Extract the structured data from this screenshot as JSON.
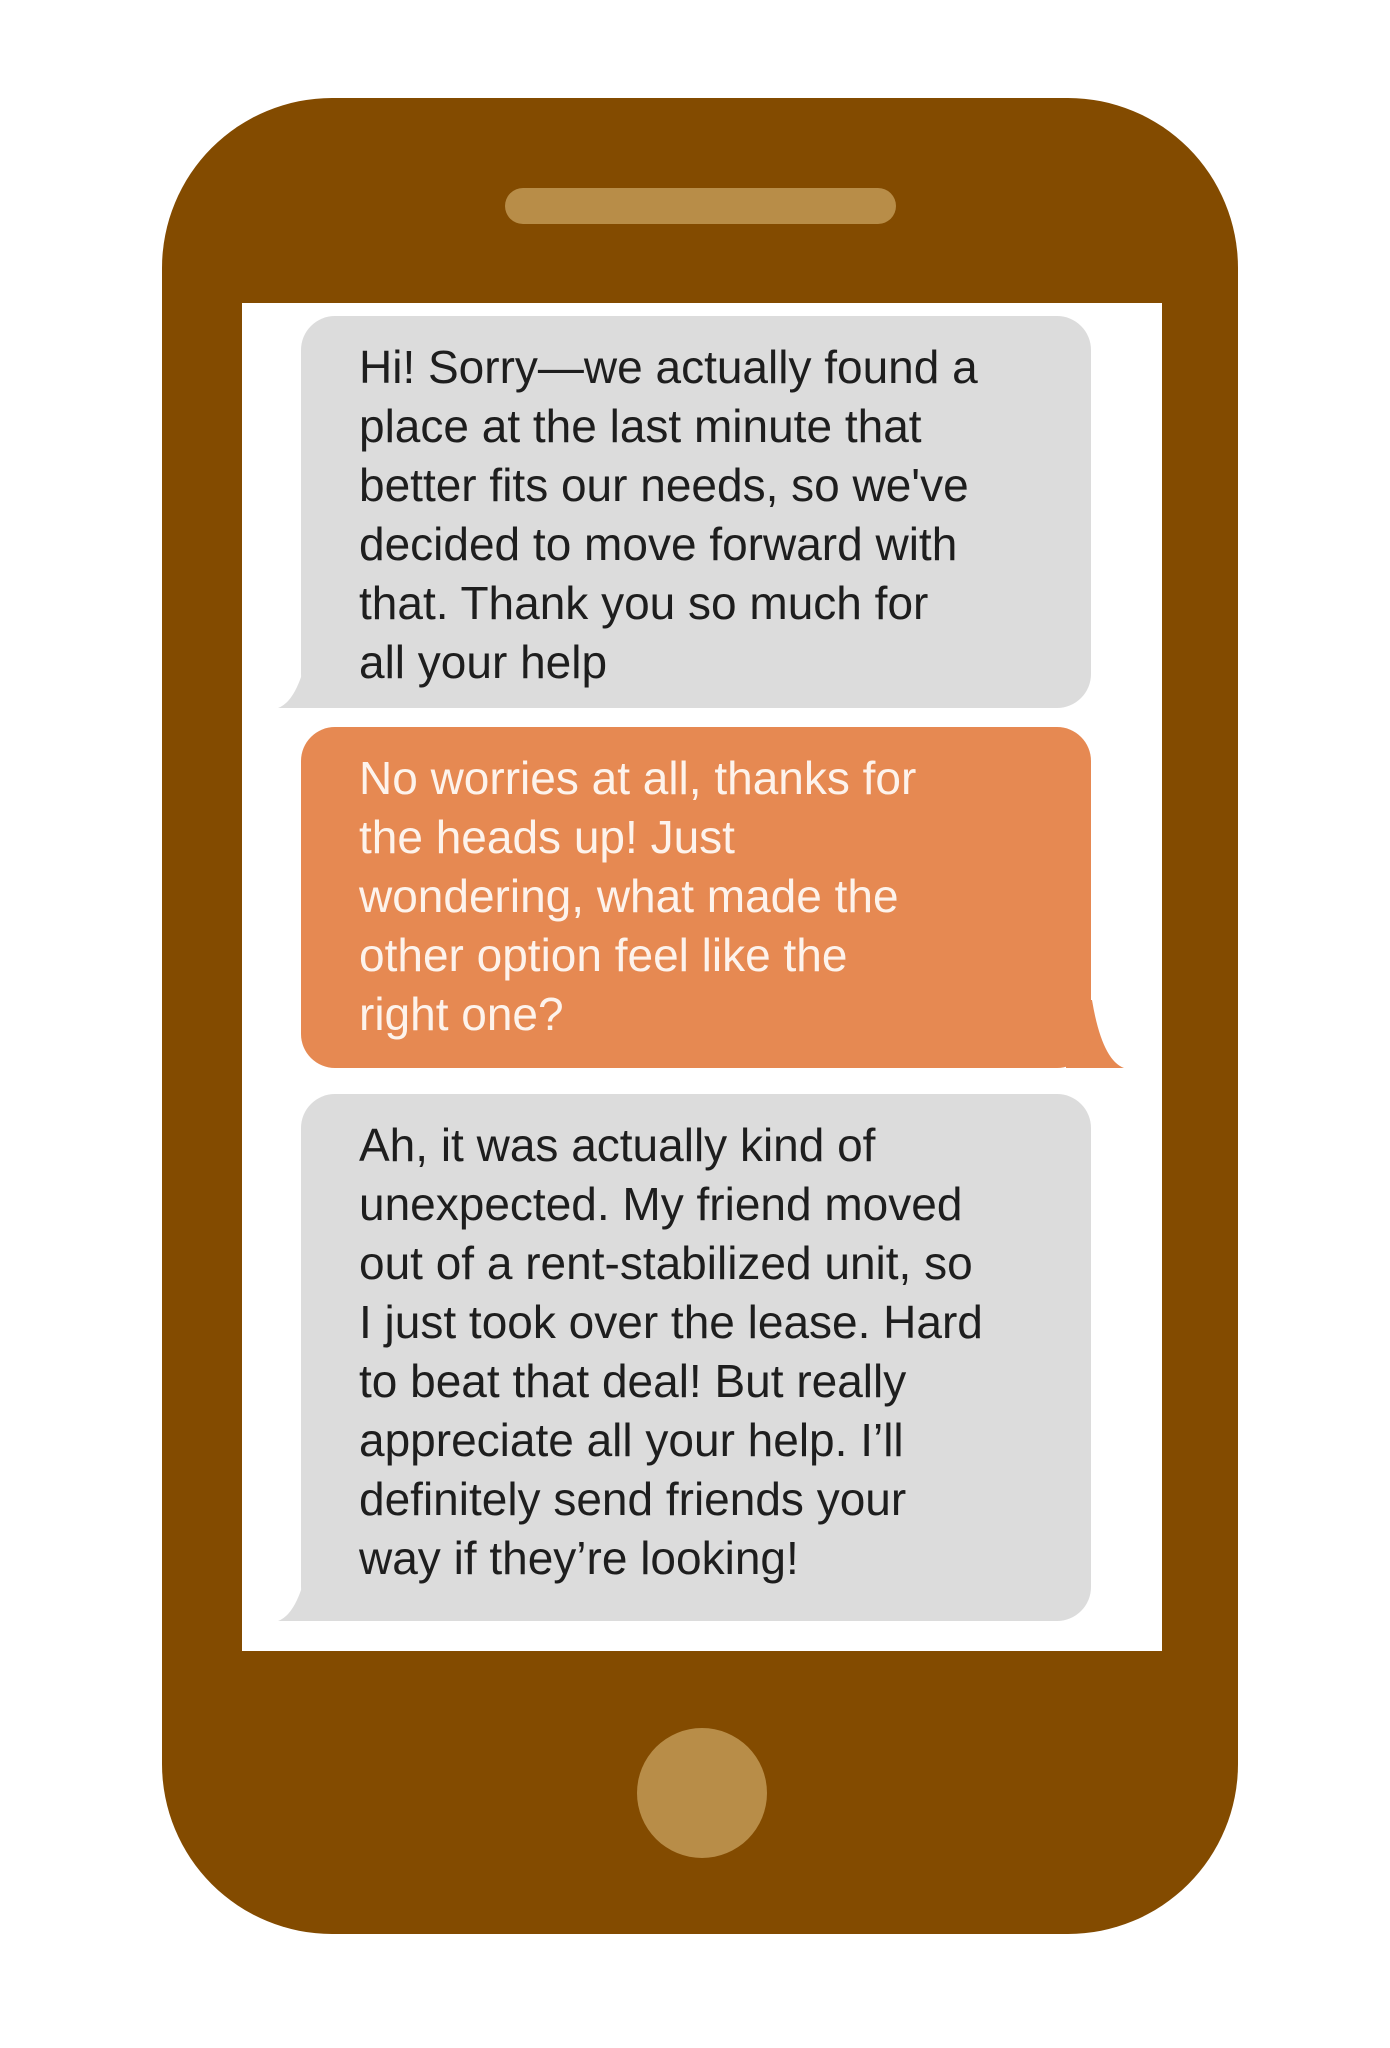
{
  "messages": [
    {
      "direction": "received",
      "text": "Hi! Sorry—we actually found a\nplace at the last minute that\nbetter fits our needs, so we've\ndecided to move forward with\nthat. Thank you so much for\nall your help"
    },
    {
      "direction": "sent",
      "text": "No worries at all, thanks for\nthe heads up! Just\nwondering, what made the\nother option feel like the\nright one?"
    },
    {
      "direction": "received",
      "text": "Ah, it was actually kind of\nunexpected. My friend moved\nout of a rent-stabilized unit, so\nI just took over the lease. Hard\nto beat that deal! But really\nappreciate all your help. I’ll\ndefinitely send friends your\nway if they’re looking!"
    }
  ],
  "colors": {
    "phone_body": "#834b00",
    "speaker_and_home_button": "#b88d48",
    "received_bubble": "#dcdcdc",
    "sent_bubble": "#e68952"
  }
}
